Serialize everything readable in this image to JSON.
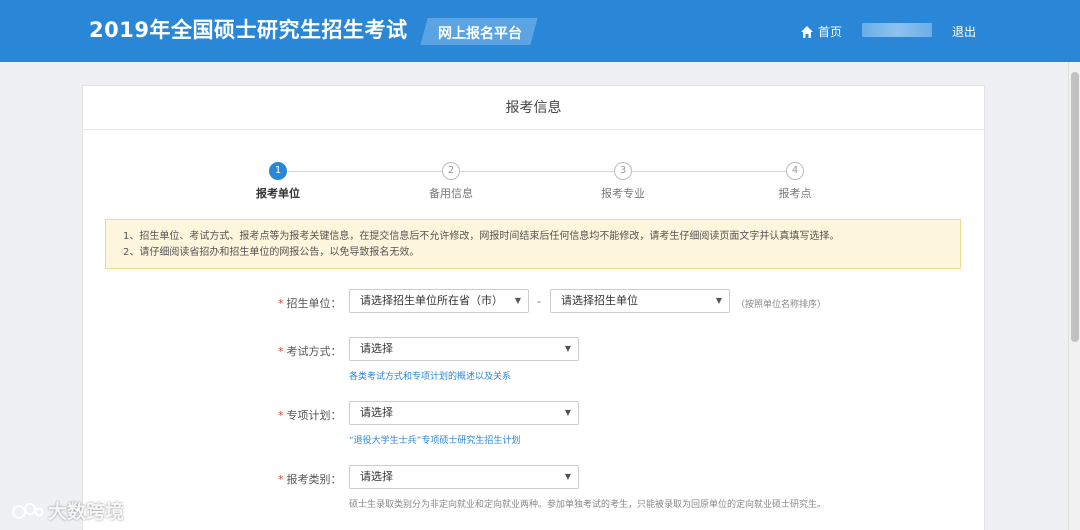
{
  "header": {
    "site_title": "2019年全国硕士研究生招生考试",
    "platform": "网上报名平台",
    "home_label": "首页",
    "logout_label": "退出"
  },
  "card": {
    "title": "报考信息"
  },
  "steps": [
    {
      "num": "1",
      "label": "报考单位",
      "active": true
    },
    {
      "num": "2",
      "label": "备用信息",
      "active": false
    },
    {
      "num": "3",
      "label": "报考专业",
      "active": false
    },
    {
      "num": "4",
      "label": "报考点",
      "active": false
    }
  ],
  "notice": {
    "line1": "1、招生单位、考试方式、报考点等为报考关键信息，在提交信息后不允许修改，网报时间结束后任何信息均不能修改，请考生仔细阅读页面文字并认真填写选择。",
    "line2": "2、请仔细阅读省招办和招生单位的网报公告，以免导致报名无效。"
  },
  "form": {
    "unit": {
      "label": "招生单位：",
      "province_value": "请选择招生单位所在省（市）",
      "unit_value": "请选择招生单位",
      "dash": "-",
      "hint": "（按照单位名称排序）"
    },
    "exam_mode": {
      "label": "考试方式：",
      "value": "请选择",
      "help": "各类考试方式和专项计划的概述以及关系"
    },
    "special_plan": {
      "label": "专项计划：",
      "value": "请选择",
      "help": "“退役大学生士兵”专项硕士研究生招生计划"
    },
    "category": {
      "label": "报考类别：",
      "value": "请选择",
      "help": "硕士生录取类别分为非定向就业和定向就业两种。参加单独考试的考生，只能被录取为回原单位的定向就业硕士研究生。"
    }
  },
  "watermark": {
    "text": "大数跨境"
  },
  "colors": {
    "primary": "#2a86d7",
    "required": "#e03c31",
    "notice_bg": "#fdf5dc"
  }
}
